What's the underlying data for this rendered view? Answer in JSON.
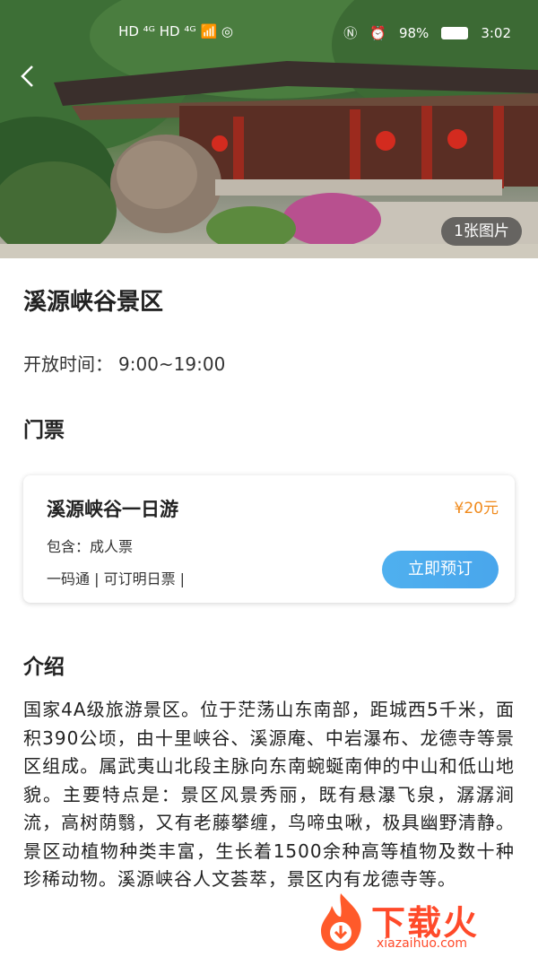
{
  "status_bar": {
    "left_icons": "HD ⁴ᴳ HD ⁴ᴳ 📶 ◎",
    "battery": "98%",
    "time": "3:02"
  },
  "hero": {
    "photo_count": "1张图片"
  },
  "spot": {
    "title": "溪源峡谷景区",
    "hours_label": "开放时间：",
    "hours_value": "9:00~19:00"
  },
  "tickets": {
    "section_title": "门票",
    "items": [
      {
        "name": "溪源峡谷一日游",
        "price": "¥20元",
        "includes": "包含：成人票",
        "tags": "一码通 | 可订明日票 |",
        "book_label": "立即预订"
      }
    ]
  },
  "intro": {
    "section_title": "介绍",
    "text": "国家4A级旅游景区。位于茫荡山东南部，距城西5千米，面积390公顷，由十里峡谷、溪源庵、中岩瀑布、龙德寺等景区组成。属武夷山北段主脉向东南蜿蜒南伸的中山和低山地貌。主要特点是：景区风景秀丽，既有悬瀑飞泉，潺潺涧流，高树荫翳，又有老藤攀缠，鸟啼虫啾，极具幽野清静。景区动植物种类丰富，生长着1500余种高等植物及数十种珍稀动物。溪源峡谷人文荟萃，景区内有龙德寺等。"
  },
  "watermark": {
    "brand": "下载火",
    "url": "xiazaihuo.com"
  },
  "colors": {
    "accent_blue": "#4aa8ed",
    "price_orange": "#f08a1c"
  }
}
